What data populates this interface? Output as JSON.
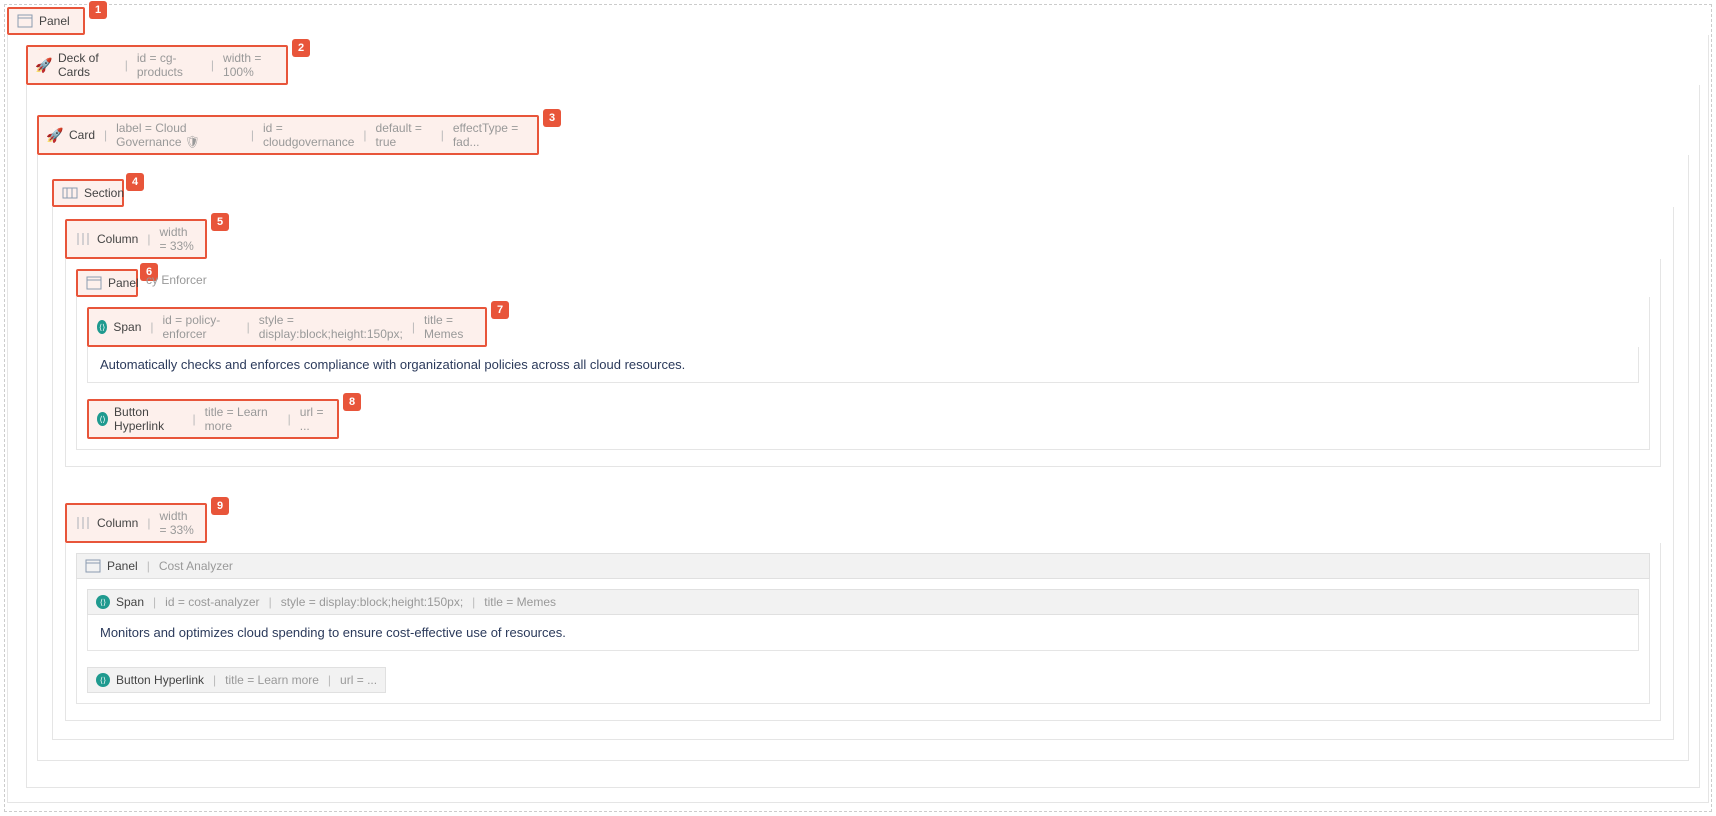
{
  "badges": [
    "1",
    "2",
    "3",
    "4",
    "5",
    "6",
    "7",
    "8",
    "9"
  ],
  "panel1": {
    "label": "Panel"
  },
  "deck": {
    "label": "Deck of Cards",
    "attrs": [
      {
        "k": "id",
        "v": "cg-products"
      },
      {
        "k": "width",
        "v": "100%"
      }
    ]
  },
  "card": {
    "label": "Card",
    "attrs": [
      {
        "k": "label",
        "v": "Cloud Governance 🛡"
      },
      {
        "k": "id",
        "v": "cloudgovernance"
      },
      {
        "k": "default",
        "v": "true"
      },
      {
        "k": "effectType",
        "v": "fad..."
      }
    ]
  },
  "section": {
    "label": "Section"
  },
  "col1": {
    "label": "Column",
    "attrs": [
      {
        "k": "width",
        "v": "33%"
      }
    ]
  },
  "panel2": {
    "label": "Panel",
    "ghost": "cy Enforcer"
  },
  "span1": {
    "label": "Span",
    "attrs": [
      {
        "k": "id",
        "v": "policy-enforcer"
      },
      {
        "k": "style",
        "v": "display:block;height:150px;"
      },
      {
        "k": "title",
        "v": "Memes"
      }
    ],
    "text": "Automatically checks and enforces compliance with organizational policies across all cloud resources."
  },
  "btn1": {
    "label": "Button Hyperlink",
    "attrs": [
      {
        "k": "title",
        "v": "Learn more"
      },
      {
        "k": "url",
        "v": "..."
      }
    ]
  },
  "col2": {
    "label": "Column",
    "attrs": [
      {
        "k": "width",
        "v": "33%"
      }
    ]
  },
  "panel3": {
    "label": "Panel",
    "title": "Cost Analyzer"
  },
  "span2": {
    "label": "Span",
    "attrs": [
      {
        "k": "id",
        "v": "cost-analyzer"
      },
      {
        "k": "style",
        "v": "display:block;height:150px;"
      },
      {
        "k": "title",
        "v": "Memes"
      }
    ],
    "text": "Monitors and optimizes cloud spending to ensure cost-effective use of resources."
  },
  "btn2": {
    "label": "Button Hyperlink",
    "attrs": [
      {
        "k": "title",
        "v": "Learn more"
      },
      {
        "k": "url",
        "v": "..."
      }
    ]
  }
}
